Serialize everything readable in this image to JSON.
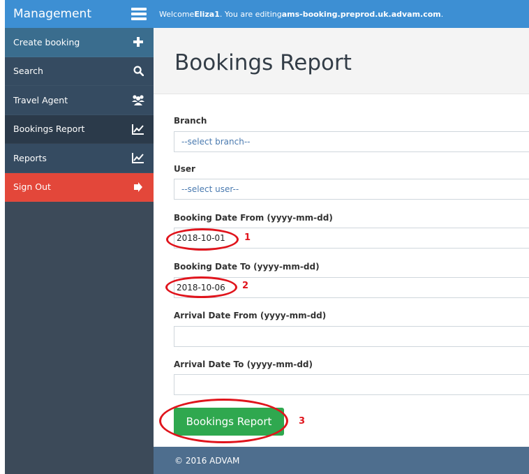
{
  "sidebar": {
    "brand": "Management",
    "items": [
      {
        "label": "Create booking",
        "icon": "plus-icon"
      },
      {
        "label": "Search",
        "icon": "search-icon"
      },
      {
        "label": "Travel Agent",
        "icon": "users-icon"
      },
      {
        "label": "Bookings Report",
        "icon": "chart-line-icon"
      },
      {
        "label": "Reports",
        "icon": "chart-line-icon"
      },
      {
        "label": "Sign Out",
        "icon": "sign-out-icon"
      }
    ],
    "active": "Bookings Report"
  },
  "topbar": {
    "welcome_prefix": "Welcome ",
    "user": "Eliza1",
    "middle": ". You are editing ",
    "site": "ams-booking.preprod.uk.advam.com",
    "suffix": "."
  },
  "page": {
    "title": "Bookings Report"
  },
  "form": {
    "branch_label": "Branch",
    "branch_placeholder": "--select branch--",
    "user_label": "User",
    "user_placeholder": "--select user--",
    "booking_from_label": "Booking Date From (yyyy-mm-dd)",
    "booking_from_value": "2018-10-01",
    "booking_to_label": "Booking Date To (yyyy-mm-dd)",
    "booking_to_value": "2018-10-06",
    "arrival_from_label": "Arrival Date From (yyyy-mm-dd)",
    "arrival_from_value": "",
    "arrival_to_label": "Arrival Date To (yyyy-mm-dd)",
    "arrival_to_value": "",
    "submit_label": "Bookings Report"
  },
  "annotations": {
    "one": "1",
    "two": "2",
    "three": "3"
  },
  "footer": {
    "text": "© 2016 ADVAM"
  },
  "colors": {
    "accent": "#3d8fd3",
    "sidebar": "#3c4a59",
    "signout": "#e3473a",
    "submit": "#2fa84f",
    "annotation": "#e0141c"
  }
}
